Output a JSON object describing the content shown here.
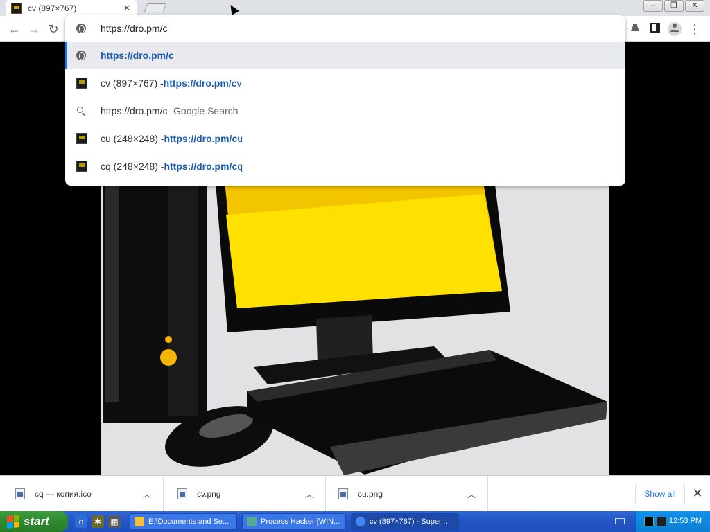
{
  "browser": {
    "tab": {
      "title": "cv (897×767)",
      "close": "✕"
    },
    "window_buttons": [
      "–",
      "❐",
      "✕"
    ],
    "toolbar": {
      "back": "←",
      "forward": "→",
      "reload": "↻",
      "menu": "⋮"
    },
    "omnibox": {
      "input": "https://dro.pm/c",
      "suggestions": [
        {
          "type": "url",
          "prefix": "",
          "url": "https://dro.pm/c",
          "url_rest": "",
          "suffix": ""
        },
        {
          "type": "page",
          "prefix": "cv (897×767) - ",
          "url": "https://dro.pm/c",
          "url_rest": "v",
          "suffix": ""
        },
        {
          "type": "search",
          "prefix": "https://dro.pm/c",
          "url": "",
          "url_rest": "",
          "suffix": " - Google Search"
        },
        {
          "type": "page",
          "prefix": "cu (248×248) - ",
          "url": "https://dro.pm/c",
          "url_rest": "u",
          "suffix": ""
        },
        {
          "type": "page",
          "prefix": "cq (248×248) - ",
          "url": "https://dro.pm/c",
          "url_rest": "q",
          "suffix": ""
        }
      ]
    },
    "downloads": {
      "items": [
        {
          "name": "cq — копия.ico"
        },
        {
          "name": "cv.png"
        },
        {
          "name": "cu.png"
        }
      ],
      "show_all": "Show all",
      "close": "✕"
    }
  },
  "taskbar": {
    "start_label": "start",
    "tasks": [
      {
        "label": "E:\\Documents and Se...",
        "active": false
      },
      {
        "label": "Process Hacker [WIN...",
        "active": false
      },
      {
        "label": "cv (897×767) - Super...",
        "active": true
      }
    ],
    "clock": "12:53 PM"
  }
}
